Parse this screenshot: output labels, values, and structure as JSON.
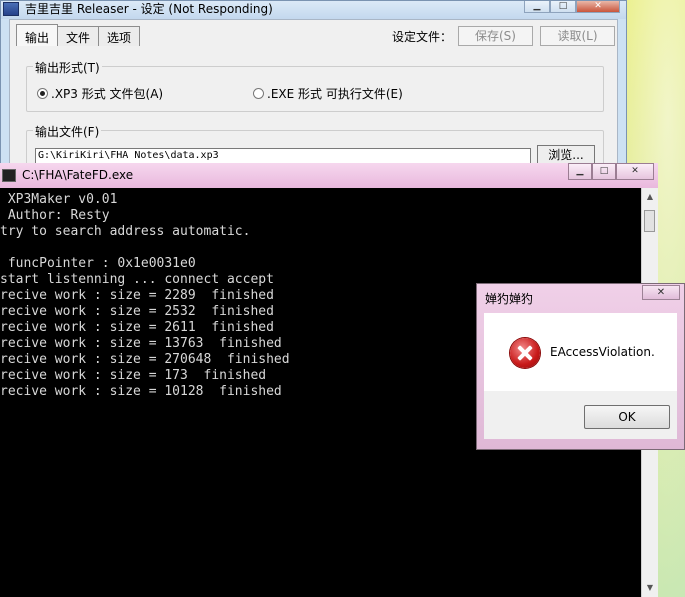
{
  "releaser": {
    "title": "吉里吉里 Releaser - 设定 (Not Responding)",
    "tabs": [
      {
        "label": "输出"
      },
      {
        "label": "文件"
      },
      {
        "label": "选项"
      }
    ],
    "settings_file_label": "设定文件：",
    "save_label": "保存(S)",
    "load_label": "读取(L)",
    "output_format": {
      "label": "输出形式(T)",
      "option_xp3": ".XP3 形式 文件包(A)",
      "option_exe": ".EXE 形式 可执行文件(E)",
      "selected": "xp3"
    },
    "output_file": {
      "label": "输出文件(F)",
      "path": "G:\\KiriKiri\\FHA Notes\\data.xp3",
      "browse_label": "浏览..."
    }
  },
  "console": {
    "title": "C:\\FHA\\FateFD.exe",
    "lines": [
      " XP3Maker v0.01",
      " Author: Resty",
      "try to search address automatic.",
      "",
      " funcPointer : 0x1e0031e0",
      "start listenning ... connect accept",
      "recive work : size = 2289  finished",
      "recive work : size = 2532  finished",
      "recive work : size = 2611  finished",
      "recive work : size = 13763  finished",
      "recive work : size = 270648  finished",
      "recive work : size = 173  finished",
      "recive work : size = 10128  finished"
    ]
  },
  "dialog": {
    "title": "婵犳婵犳",
    "message": "EAccessViolation.",
    "ok_label": "OK"
  },
  "icons": {
    "error": "error-x-icon",
    "console": "console-icon",
    "app": "app-icon"
  }
}
